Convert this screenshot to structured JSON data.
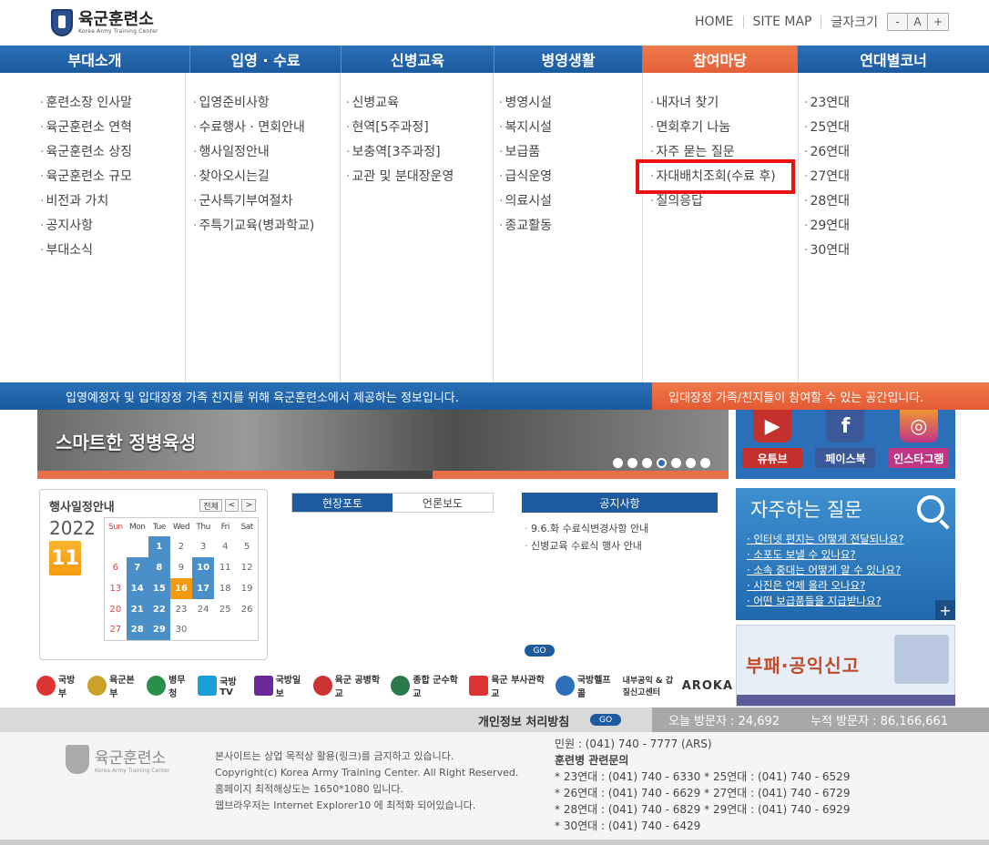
{
  "header": {
    "logo_kr": "육군훈련소",
    "logo_en": "Korea Army Training Center",
    "util": {
      "home": "HOME",
      "sitemap": "SITE MAP",
      "fontsize": "글자크기",
      "minus": "-",
      "a": "A",
      "plus": "+"
    }
  },
  "gnb": [
    "부대소개",
    "입영 · 수료",
    "신병교육",
    "병영생활",
    "참여마당",
    "연대별코너"
  ],
  "submenu": [
    [
      "훈련소장 인사말",
      "육군훈련소 연혁",
      "육군훈련소 상징",
      "육군훈련소 규모",
      "비전과 가치",
      "공지사항",
      "부대소식"
    ],
    [
      "입영준비사항",
      "수료행사 · 면회안내",
      "행사일정안내",
      "찾아오시는길",
      "군사특기부여절차",
      "주특기교육(병과학교)"
    ],
    [
      "신병교육",
      "현역[5주과정]",
      "보충역[3주과정]",
      "교관 및 분대장운영"
    ],
    [
      "병영시설",
      "복지시설",
      "보급품",
      "급식운영",
      "의료시설",
      "종교활동"
    ],
    [
      "내자녀 찾기",
      "면회후기 나눔",
      "자주 묻는 질문",
      "자대배치조회(수료 후)",
      "질의응답"
    ],
    [
      "23연대",
      "25연대",
      "26연대",
      "27연대",
      "28연대",
      "29연대",
      "30연대"
    ]
  ],
  "infobar": {
    "left": "입영예정자 및 입대장정 가족 친지를 위해 육군훈련소에서 제공하는 정보입니다.",
    "right": "입대장정 가족/친지들이 참여할 수 있는 공간입니다."
  },
  "banner": {
    "text": "스마트한 정병육성"
  },
  "social": [
    {
      "label": "유튜브",
      "icon": "youtube-icon",
      "color": "#c4302b"
    },
    {
      "label": "페이스북",
      "icon": "facebook-icon",
      "color": "#3b5998"
    },
    {
      "label": "인스타그램",
      "icon": "instagram-icon",
      "color": "#c13584"
    }
  ],
  "schedule": {
    "title": "행사일정안내",
    "all": "전체",
    "prev": "<",
    "next": ">",
    "year": "2022",
    "month": "11",
    "weekdays": [
      "Sun",
      "Mon",
      "Tue",
      "Wed",
      "Thu",
      "Fri",
      "Sat"
    ],
    "weeks": [
      [
        "",
        "",
        "1",
        "2",
        "3",
        "4",
        "5"
      ],
      [
        "6",
        "7",
        "8",
        "9",
        "10",
        "11",
        "12"
      ],
      [
        "13",
        "14",
        "15",
        "16",
        "17",
        "18",
        "19"
      ],
      [
        "20",
        "21",
        "22",
        "23",
        "24",
        "25",
        "26"
      ],
      [
        "27",
        "28",
        "29",
        "30",
        "",
        "",
        ""
      ]
    ],
    "event_days": [
      "1",
      "7",
      "8",
      "10",
      "14",
      "15",
      "17",
      "21",
      "22",
      "28",
      "29"
    ],
    "today": "16"
  },
  "photo_tabs": [
    "현장포토",
    "언론보도"
  ],
  "notice": {
    "title": "공지사항",
    "items": [
      "9.6.화 수료식변경사항 안내",
      "신병교육 수료식 행사 안내"
    ],
    "go": "GO"
  },
  "faq": {
    "title": "자주하는 질문",
    "items": [
      "인터넷 편지는 어떻게 전달되나요?",
      "소포도 보낼 수 있나요?",
      "소속 중대는 어떻게 알 수 있나요?",
      "사진은 언제 올라 오나요?",
      "어떤 보급품들을 지급받나요?"
    ],
    "plus": "+"
  },
  "report": {
    "title": "부패·공익신고"
  },
  "partners": [
    "국방부",
    "육군본부",
    "병무청",
    "국방TV",
    "국방일보",
    "육군 공병학교",
    "종합 군수학교",
    "육군 부사관학교",
    "국방헬프콜",
    "내부공익 & 갑질신고센터",
    "AROKA"
  ],
  "footer": {
    "privacy": "개인정보 처리방침",
    "go": "GO",
    "today_visitors": "오늘 방문자 : 24,692",
    "total_visitors": "누적 방문자 : 86,166,661",
    "info": [
      "본사이트는 상업 목적상 활용(링크)를 금지하고 있습니다.",
      "Copyright(c) Korea Army Training Center. All Right Reserved.",
      "홈페이지 최적해상도는 1650*1080 입니다.",
      "웹브라우저는 Internet Explorer10 에 최적화 되어있습니다."
    ],
    "contact": [
      "민원 : (041) 740 - 7777 (ARS)",
      "훈련병 관련문의",
      "* 23연대 : (041) 740 - 6330  * 25연대 : (041) 740 - 6529",
      "* 26연대 : (041) 740 - 6629  * 27연대 : (041) 740 - 6729",
      "* 28연대 : (041) 740 - 6829  * 29연대 : (041) 740 - 6929",
      "* 30연대 : (041) 740 - 6429"
    ]
  }
}
